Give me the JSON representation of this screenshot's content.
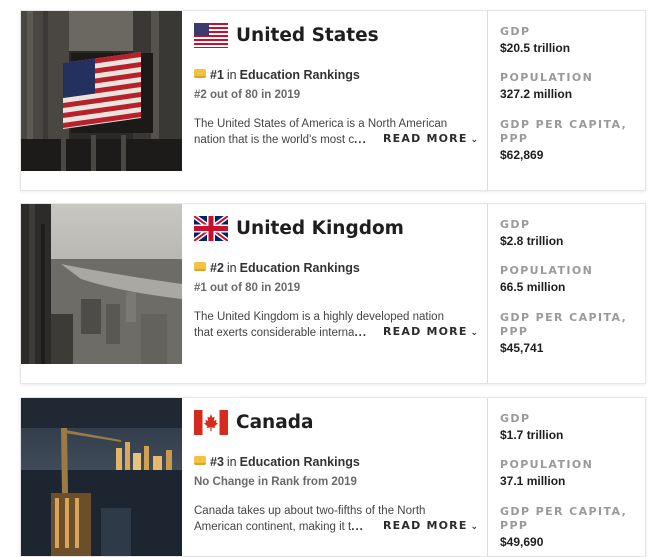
{
  "stat_labels": {
    "gdp": "GDP",
    "population": "POPULATION",
    "gdp_per_capita": "GDP PER CAPITA, PPP"
  },
  "read_more_label": "READ MORE",
  "rankings_label": "Education Rankings",
  "in_label": "in",
  "colors": {
    "rank_icon": "#f4c242",
    "label_gray": "#9a9a9a"
  },
  "countries": [
    {
      "name": "United States",
      "flag_icon": "us-flag-icon",
      "rank": "#1",
      "sub": "#2 out of 80 in 2019",
      "desc_line1": "The United States of America is a North American",
      "desc_line2": "nation that is the world's most c",
      "ellipsis": "...",
      "gdp": "$20.5 trillion",
      "population": "327.2 million",
      "gdp_per_capita": "$62,869"
    },
    {
      "name": "United Kingdom",
      "flag_icon": "uk-flag-icon",
      "rank": "#2",
      "sub": "#1 out of 80 in 2019",
      "desc_line1": "The United Kingdom is a highly developed nation",
      "desc_line2": "that exerts considerable interna",
      "ellipsis": "...",
      "gdp": "$2.8 trillion",
      "population": "66.5 million",
      "gdp_per_capita": "$45,741"
    },
    {
      "name": "Canada",
      "flag_icon": "canada-flag-icon",
      "rank": "#3",
      "sub": "No Change in Rank from 2019",
      "desc_line1": "Canada takes up about two-fifths of the North",
      "desc_line2": "American continent, making it t",
      "ellipsis": "...",
      "gdp": "$1.7 trillion",
      "population": "37.1 million",
      "gdp_per_capita": "$49,690"
    }
  ]
}
